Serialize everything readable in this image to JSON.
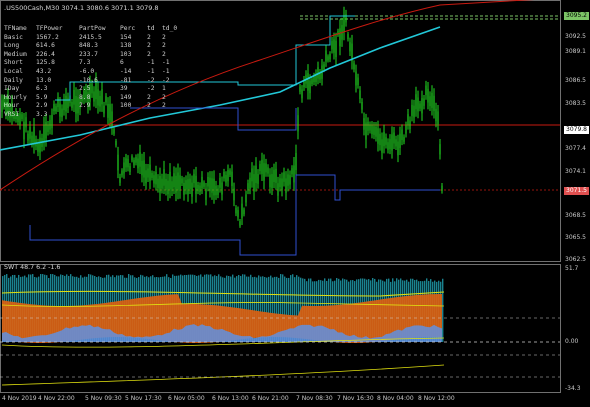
{
  "header": {
    "symbol_line": ".US500Cash,M30  3074.1 3080.6 3071.1 3079.8"
  },
  "table": {
    "headers": [
      "TFName",
      "TFPower",
      "PartPow",
      "Perc",
      "td",
      "td_0"
    ],
    "rows": [
      [
        "Basic",
        "1567.2",
        "2415.5",
        "154",
        "2",
        "2"
      ],
      [
        "Long",
        "614.6",
        "848.3",
        "138",
        "2",
        "2"
      ],
      [
        "Medium",
        "226.4",
        "233.7",
        "103",
        "2",
        "2"
      ],
      [
        "Short",
        "125.8",
        "7.3",
        "6",
        "-1",
        "-1"
      ],
      [
        "Local",
        "43.2",
        "-6.0",
        "-14",
        "-1",
        "-1"
      ],
      [
        "Daily",
        "13.0",
        "-10.6",
        "-81",
        "-2",
        "-2"
      ],
      [
        "IDay",
        "6.3",
        "2.5",
        "39",
        "-2",
        "1"
      ],
      [
        "Hourly",
        "5.9",
        "8.8",
        "149",
        "2",
        "2"
      ],
      [
        "Hour",
        "2.9",
        "2.9",
        "100",
        "2",
        "2"
      ],
      [
        "VRSI",
        "3.3",
        "",
        "",
        "",
        ""
      ]
    ]
  },
  "price_axis": [
    "3092.5",
    "3089.1",
    "3086.5",
    "3083.5",
    "3080.2",
    "3077.4",
    "3074.1",
    "3068.5",
    "3065.5",
    "3062.5"
  ],
  "price_tags": {
    "top": {
      "label": "3095.2",
      "color": "#7cc466"
    },
    "mid": {
      "label": "3079.8",
      "color": "#ffffff"
    },
    "low": {
      "label": "3071.5",
      "color": "#e05050"
    }
  },
  "indicator": {
    "label": "SWT 48.7 6.2 -1.6",
    "axis": [
      "51.7",
      "0.00",
      "-34.3"
    ]
  },
  "time_axis": [
    "4 Nov 2019",
    "4 Nov 22:00",
    "5 Nov 09:30",
    "5 Nov 17:30",
    "6 Nov 05:00",
    "6 Nov 13:00",
    "6 Nov 21:00",
    "7 Nov 08:30",
    "7 Nov 16:30",
    "8 Nov 04:00",
    "8 Nov 12:00"
  ],
  "colors": {
    "bull": "#22dd22",
    "bear": "#22dd22",
    "cyan": "#22c8d8",
    "red": "#c81a10",
    "blue": "#3050d0",
    "ind_orange": "#e06010",
    "ind_teal": "#1e9aa8",
    "ind_blue": "#6090e0",
    "yellow": "#e0e010"
  }
}
